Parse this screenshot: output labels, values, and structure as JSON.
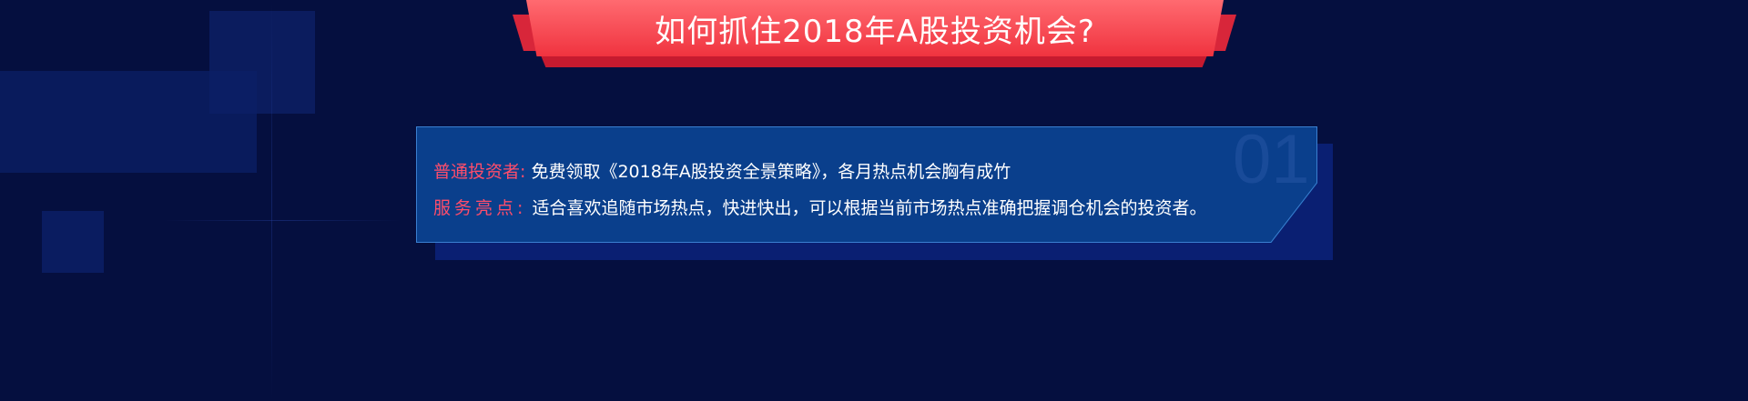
{
  "header": {
    "title": "如何抓住2018年A股投资机会?"
  },
  "card": {
    "number": "01",
    "rows": [
      {
        "label": "普通投资者:",
        "value": "免费领取《2018年A股投资全景策略》，各月热点机会胸有成竹"
      },
      {
        "label": "服务亮点:",
        "value": "适合喜欢追随市场热点，快进快出，可以根据当前市场热点准确把握调仓机会的投资者。"
      }
    ]
  },
  "colors": {
    "background": "#050f3f",
    "ribbon": "#f0333f",
    "card": "#0a3f8c",
    "label_accent": "#ff4d6b",
    "card_border": "#3a7fd0"
  }
}
